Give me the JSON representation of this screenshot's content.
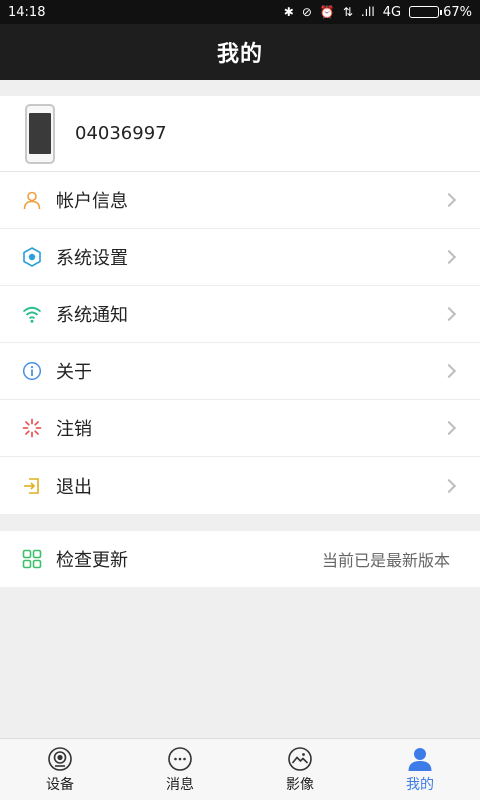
{
  "status_bar": {
    "time": "14:18",
    "network": "4G",
    "signal_glyph": ".ıll",
    "battery": "67%",
    "battery_level": 0.67
  },
  "header": {
    "title": "我的"
  },
  "device": {
    "id": "04036997"
  },
  "menu": {
    "items": [
      {
        "label": "帐户信息",
        "icon": "person-icon",
        "color": "#f0a040"
      },
      {
        "label": "系统设置",
        "icon": "settings-icon",
        "color": "#2a9fd8"
      },
      {
        "label": "系统通知",
        "icon": "wifi-icon",
        "color": "#2bbf8a"
      },
      {
        "label": "关于",
        "icon": "info-icon",
        "color": "#4a90e2"
      },
      {
        "label": "注销",
        "icon": "logout-spinner-icon",
        "color": "#e85c5c"
      },
      {
        "label": "退出",
        "icon": "exit-icon",
        "color": "#e0b020"
      }
    ]
  },
  "update": {
    "label": "检查更新",
    "status": "当前已是最新版本",
    "icon": "update-grid-icon",
    "color": "#3bbf6a"
  },
  "tabs": [
    {
      "label": "设备",
      "icon": "device-icon",
      "active": false
    },
    {
      "label": "消息",
      "icon": "message-icon",
      "active": false
    },
    {
      "label": "影像",
      "icon": "image-icon",
      "active": false
    },
    {
      "label": "我的",
      "icon": "profile-icon",
      "active": true
    }
  ],
  "colors": {
    "accent": "#3d7be8",
    "header_bg": "#1e1e1e",
    "page_bg": "#efefef"
  }
}
